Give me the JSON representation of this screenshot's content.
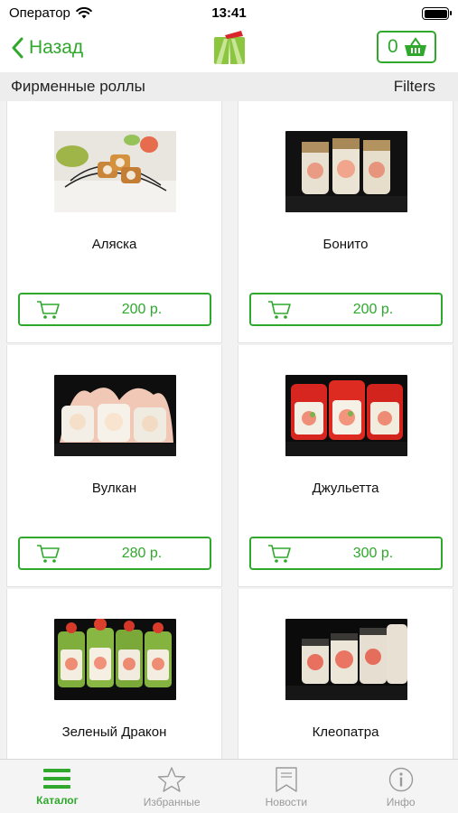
{
  "status_bar": {
    "carrier": "Оператор",
    "time": "13:41"
  },
  "nav": {
    "back_label": "Назад",
    "cart_count": "0"
  },
  "colors": {
    "accent": "#2fa82c",
    "header_bg": "#ededed",
    "tab_bg": "#f4f4f4"
  },
  "category": {
    "title": "Фирменные роллы",
    "filters_label": "Filters"
  },
  "products": [
    {
      "name": "Аляска",
      "price": "200 р."
    },
    {
      "name": "Бонито",
      "price": "200 р."
    },
    {
      "name": "Вулкан",
      "price": "280 р."
    },
    {
      "name": "Джульетта",
      "price": "300 р."
    },
    {
      "name": "Зеленый Дракон",
      "price": ""
    },
    {
      "name": "Клеопатра",
      "price": ""
    }
  ],
  "tabs": [
    {
      "label": "Каталог",
      "icon": "menu-lines-icon",
      "active": true
    },
    {
      "label": "Избранные",
      "icon": "star-icon",
      "active": false
    },
    {
      "label": "Новости",
      "icon": "bookmark-icon",
      "active": false
    },
    {
      "label": "Инфо",
      "icon": "info-icon",
      "active": false
    }
  ]
}
